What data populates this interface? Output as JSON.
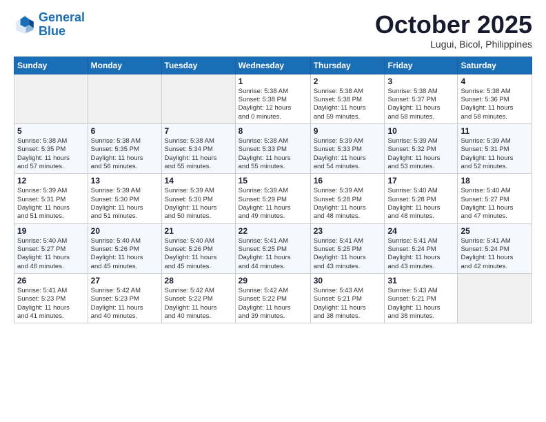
{
  "logo": {
    "line1": "General",
    "line2": "Blue"
  },
  "title": "October 2025",
  "subtitle": "Lugui, Bicol, Philippines",
  "days_of_week": [
    "Sunday",
    "Monday",
    "Tuesday",
    "Wednesday",
    "Thursday",
    "Friday",
    "Saturday"
  ],
  "weeks": [
    [
      {
        "day": "",
        "text": ""
      },
      {
        "day": "",
        "text": ""
      },
      {
        "day": "",
        "text": ""
      },
      {
        "day": "1",
        "text": "Sunrise: 5:38 AM\nSunset: 5:38 PM\nDaylight: 12 hours\nand 0 minutes."
      },
      {
        "day": "2",
        "text": "Sunrise: 5:38 AM\nSunset: 5:38 PM\nDaylight: 11 hours\nand 59 minutes."
      },
      {
        "day": "3",
        "text": "Sunrise: 5:38 AM\nSunset: 5:37 PM\nDaylight: 11 hours\nand 58 minutes."
      },
      {
        "day": "4",
        "text": "Sunrise: 5:38 AM\nSunset: 5:36 PM\nDaylight: 11 hours\nand 58 minutes."
      }
    ],
    [
      {
        "day": "5",
        "text": "Sunrise: 5:38 AM\nSunset: 5:35 PM\nDaylight: 11 hours\nand 57 minutes."
      },
      {
        "day": "6",
        "text": "Sunrise: 5:38 AM\nSunset: 5:35 PM\nDaylight: 11 hours\nand 56 minutes."
      },
      {
        "day": "7",
        "text": "Sunrise: 5:38 AM\nSunset: 5:34 PM\nDaylight: 11 hours\nand 55 minutes."
      },
      {
        "day": "8",
        "text": "Sunrise: 5:38 AM\nSunset: 5:33 PM\nDaylight: 11 hours\nand 55 minutes."
      },
      {
        "day": "9",
        "text": "Sunrise: 5:39 AM\nSunset: 5:33 PM\nDaylight: 11 hours\nand 54 minutes."
      },
      {
        "day": "10",
        "text": "Sunrise: 5:39 AM\nSunset: 5:32 PM\nDaylight: 11 hours\nand 53 minutes."
      },
      {
        "day": "11",
        "text": "Sunrise: 5:39 AM\nSunset: 5:31 PM\nDaylight: 11 hours\nand 52 minutes."
      }
    ],
    [
      {
        "day": "12",
        "text": "Sunrise: 5:39 AM\nSunset: 5:31 PM\nDaylight: 11 hours\nand 51 minutes."
      },
      {
        "day": "13",
        "text": "Sunrise: 5:39 AM\nSunset: 5:30 PM\nDaylight: 11 hours\nand 51 minutes."
      },
      {
        "day": "14",
        "text": "Sunrise: 5:39 AM\nSunset: 5:30 PM\nDaylight: 11 hours\nand 50 minutes."
      },
      {
        "day": "15",
        "text": "Sunrise: 5:39 AM\nSunset: 5:29 PM\nDaylight: 11 hours\nand 49 minutes."
      },
      {
        "day": "16",
        "text": "Sunrise: 5:39 AM\nSunset: 5:28 PM\nDaylight: 11 hours\nand 48 minutes."
      },
      {
        "day": "17",
        "text": "Sunrise: 5:40 AM\nSunset: 5:28 PM\nDaylight: 11 hours\nand 48 minutes."
      },
      {
        "day": "18",
        "text": "Sunrise: 5:40 AM\nSunset: 5:27 PM\nDaylight: 11 hours\nand 47 minutes."
      }
    ],
    [
      {
        "day": "19",
        "text": "Sunrise: 5:40 AM\nSunset: 5:27 PM\nDaylight: 11 hours\nand 46 minutes."
      },
      {
        "day": "20",
        "text": "Sunrise: 5:40 AM\nSunset: 5:26 PM\nDaylight: 11 hours\nand 45 minutes."
      },
      {
        "day": "21",
        "text": "Sunrise: 5:40 AM\nSunset: 5:26 PM\nDaylight: 11 hours\nand 45 minutes."
      },
      {
        "day": "22",
        "text": "Sunrise: 5:41 AM\nSunset: 5:25 PM\nDaylight: 11 hours\nand 44 minutes."
      },
      {
        "day": "23",
        "text": "Sunrise: 5:41 AM\nSunset: 5:25 PM\nDaylight: 11 hours\nand 43 minutes."
      },
      {
        "day": "24",
        "text": "Sunrise: 5:41 AM\nSunset: 5:24 PM\nDaylight: 11 hours\nand 43 minutes."
      },
      {
        "day": "25",
        "text": "Sunrise: 5:41 AM\nSunset: 5:24 PM\nDaylight: 11 hours\nand 42 minutes."
      }
    ],
    [
      {
        "day": "26",
        "text": "Sunrise: 5:41 AM\nSunset: 5:23 PM\nDaylight: 11 hours\nand 41 minutes."
      },
      {
        "day": "27",
        "text": "Sunrise: 5:42 AM\nSunset: 5:23 PM\nDaylight: 11 hours\nand 40 minutes."
      },
      {
        "day": "28",
        "text": "Sunrise: 5:42 AM\nSunset: 5:22 PM\nDaylight: 11 hours\nand 40 minutes."
      },
      {
        "day": "29",
        "text": "Sunrise: 5:42 AM\nSunset: 5:22 PM\nDaylight: 11 hours\nand 39 minutes."
      },
      {
        "day": "30",
        "text": "Sunrise: 5:43 AM\nSunset: 5:21 PM\nDaylight: 11 hours\nand 38 minutes."
      },
      {
        "day": "31",
        "text": "Sunrise: 5:43 AM\nSunset: 5:21 PM\nDaylight: 11 hours\nand 38 minutes."
      },
      {
        "day": "",
        "text": ""
      }
    ]
  ]
}
